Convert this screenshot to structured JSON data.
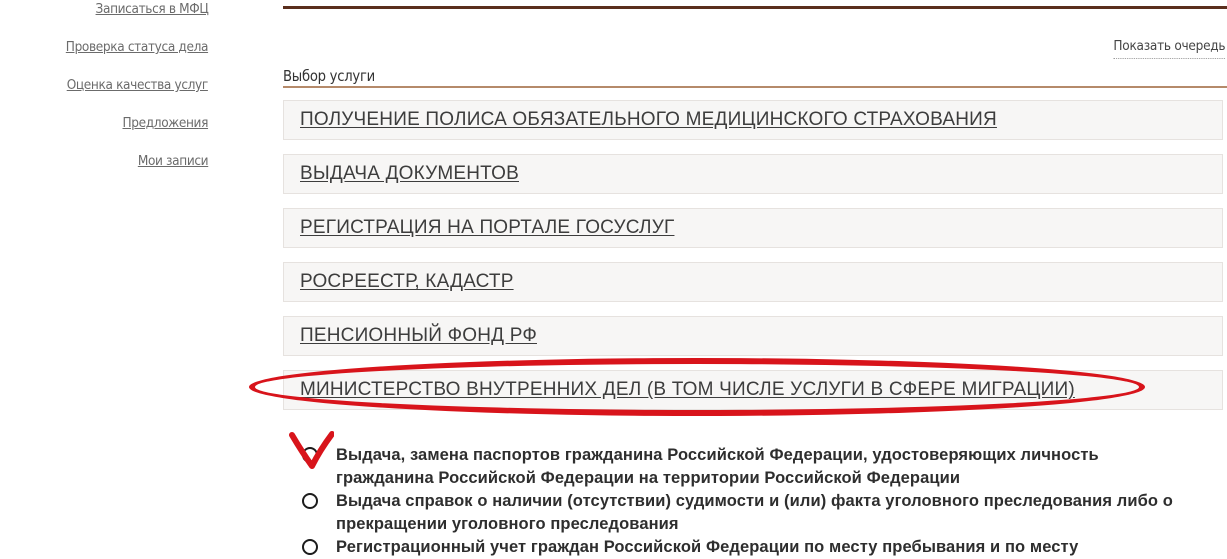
{
  "sidebar": {
    "items": [
      {
        "label": "Записаться в МФЦ"
      },
      {
        "label": "Проверка статуса дела"
      },
      {
        "label": "Оценка качества услуг"
      },
      {
        "label": "Предложения"
      },
      {
        "label": "Мои записи"
      }
    ]
  },
  "header": {
    "show_queue_label": "Показать очередь"
  },
  "main": {
    "section_title": "Выбор услуги",
    "services": [
      {
        "label": "ПОЛУЧЕНИЕ ПОЛИСА ОБЯЗАТЕЛЬНОГО МЕДИЦИНСКОГО СТРАХОВАНИЯ"
      },
      {
        "label": "ВЫДАЧА ДОКУМЕНТОВ"
      },
      {
        "label": "РЕГИСТРАЦИЯ НА ПОРТАЛЕ ГОСУСЛУГ"
      },
      {
        "label": "РОСРЕЕСТР, КАДАСТР"
      },
      {
        "label": "ПЕНСИОННЫЙ ФОНД РФ"
      },
      {
        "label": "МИНИСТЕРСТВО ВНУТРЕННИХ ДЕЛ (В ТОМ ЧИСЛЕ УСЛУГИ В СФЕРЕ МИГРАЦИИ)"
      }
    ],
    "sub_options": [
      {
        "label": "Выдача, замена паспортов гражданина Российской Федерации, удостоверяющих личность гражданина Российской Федерации на территории Российской Федерации"
      },
      {
        "label": "Выдача справок о наличии (отсутствии) судимости и (или) факта уголовного преследования либо о прекращении уголовного преследования"
      },
      {
        "label": "Регистрационный учет граждан Российской Федерации по месту пребывания и по месту"
      }
    ]
  },
  "annotation": {
    "color": "#d8141b"
  }
}
